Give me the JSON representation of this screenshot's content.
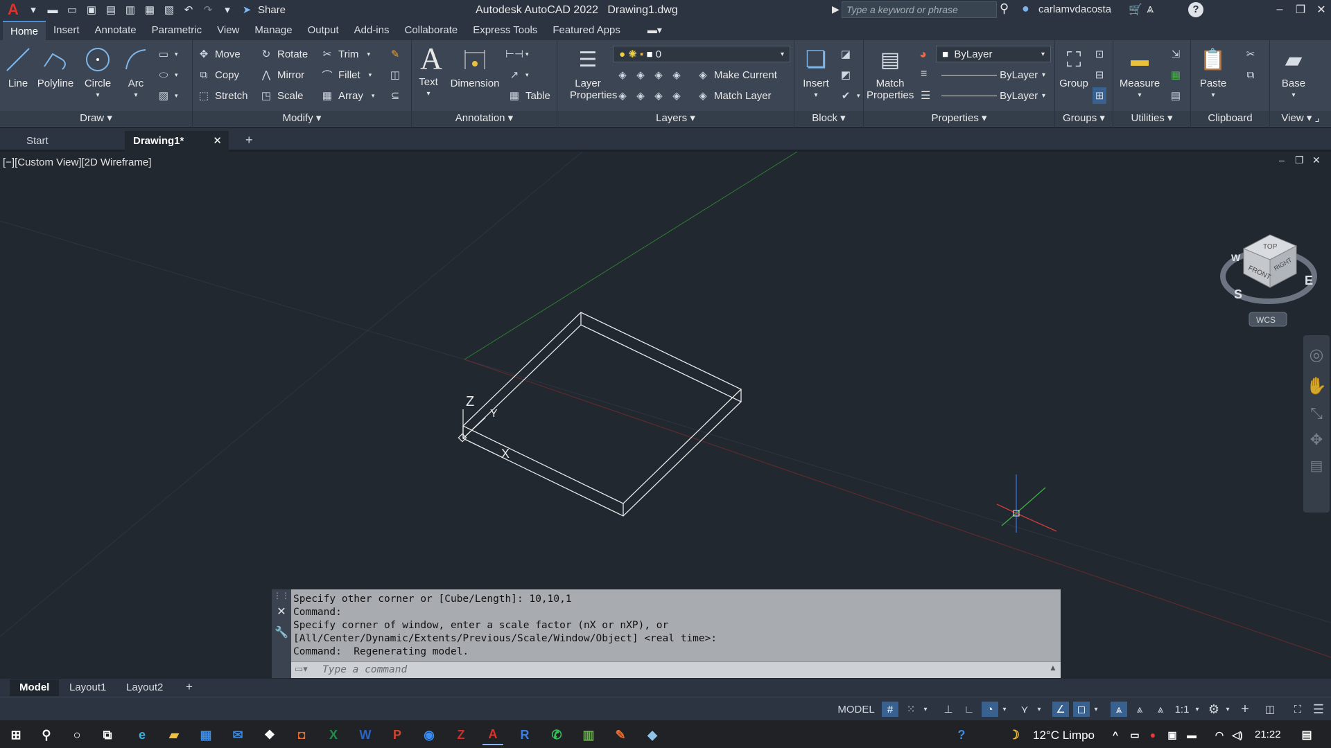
{
  "titlebar": {
    "app_title": "Autodesk AutoCAD 2022",
    "file_name": "Drawing1.dwg",
    "share_label": "Share",
    "search_placeholder": "Type a keyword or phrase",
    "user_name": "carlamvdacosta"
  },
  "ribbon_tabs": [
    "Home",
    "Insert",
    "Annotate",
    "Parametric",
    "View",
    "Manage",
    "Output",
    "Add-ins",
    "Collaborate",
    "Express Tools",
    "Featured Apps"
  ],
  "active_ribbon_tab": "Home",
  "ribbon": {
    "draw": {
      "title": "Draw",
      "line": "Line",
      "polyline": "Polyline",
      "circle": "Circle",
      "arc": "Arc"
    },
    "modify": {
      "title": "Modify",
      "move": "Move",
      "rotate": "Rotate",
      "trim": "Trim",
      "copy": "Copy",
      "mirror": "Mirror",
      "fillet": "Fillet",
      "stretch": "Stretch",
      "scale": "Scale",
      "array": "Array"
    },
    "annotation": {
      "title": "Annotation",
      "text": "Text",
      "dimension": "Dimension",
      "table": "Table"
    },
    "layers": {
      "title": "Layers",
      "layer_properties": "Layer Properties",
      "current_layer": "0",
      "make_current": "Make Current",
      "match_layer": "Match Layer"
    },
    "block": {
      "title": "Block",
      "insert": "Insert"
    },
    "properties": {
      "title": "Properties",
      "match_properties": "Match Properties",
      "color": "ByLayer",
      "linetype": "ByLayer",
      "lineweight": "ByLayer"
    },
    "groups": {
      "title": "Groups",
      "group": "Group"
    },
    "utilities": {
      "title": "Utilities",
      "measure": "Measure"
    },
    "clipboard": {
      "title": "Clipboard",
      "paste": "Paste"
    },
    "view": {
      "title": "View",
      "base": "Base"
    }
  },
  "doc_tabs": {
    "start": "Start",
    "drawing": "Drawing1*"
  },
  "viewport": {
    "label": "[−][Custom View][2D Wireframe]",
    "ucs_x": "X",
    "ucs_y": "Y",
    "ucs_z": "Z",
    "viewcube": {
      "top": "TOP",
      "front": "FRONT",
      "right": "RIGHT",
      "s": "S",
      "e": "E",
      "w": "W",
      "wcs": "WCS"
    }
  },
  "command": {
    "history": [
      "Specify other corner or [Cube/Length]: 10,10,1",
      "Command:",
      "Specify corner of window, enter a scale factor (nX or nXP), or",
      "[All/Center/Dynamic/Extents/Previous/Scale/Window/Object] <real time>:",
      "Command:  Regenerating model."
    ],
    "placeholder": "Type a command"
  },
  "layout_tabs": {
    "model": "Model",
    "layout1": "Layout1",
    "layout2": "Layout2"
  },
  "status": {
    "model": "MODEL",
    "scale": "1:1"
  },
  "taskbar": {
    "weather": "12°C  Limpo",
    "time": "21:22"
  },
  "colors": {
    "accent": "#38618f",
    "app_red": "#e0312b",
    "axis_green": "#2f8a2f",
    "axis_red": "#a83232"
  }
}
